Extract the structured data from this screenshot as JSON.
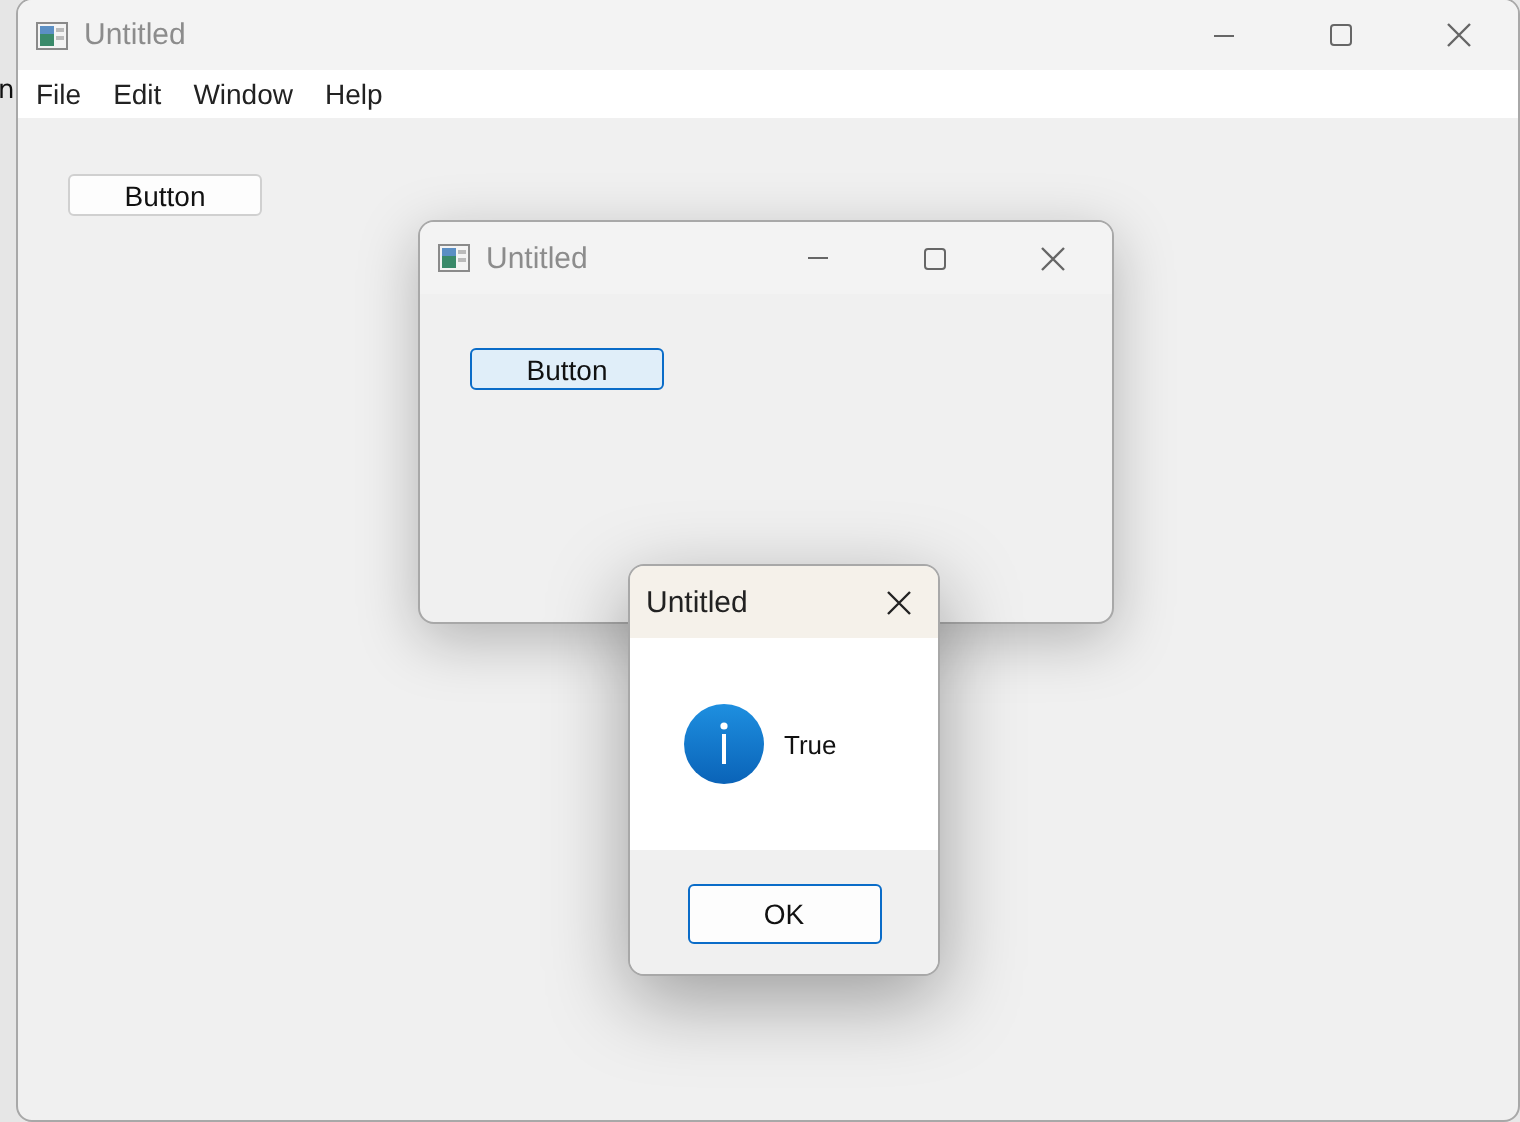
{
  "background_window": {
    "text": "n"
  },
  "main_window": {
    "title": "Untitled",
    "menu": [
      "File",
      "Edit",
      "Window",
      "Help"
    ],
    "buttons": [
      {
        "label": "Button",
        "focused": false
      }
    ]
  },
  "child_window": {
    "title": "Untitled",
    "buttons": [
      {
        "label": "Button",
        "focused": true
      }
    ]
  },
  "dialog": {
    "title": "Untitled",
    "message": "True",
    "buttons": [
      {
        "label": "OK",
        "focused": true
      }
    ]
  }
}
